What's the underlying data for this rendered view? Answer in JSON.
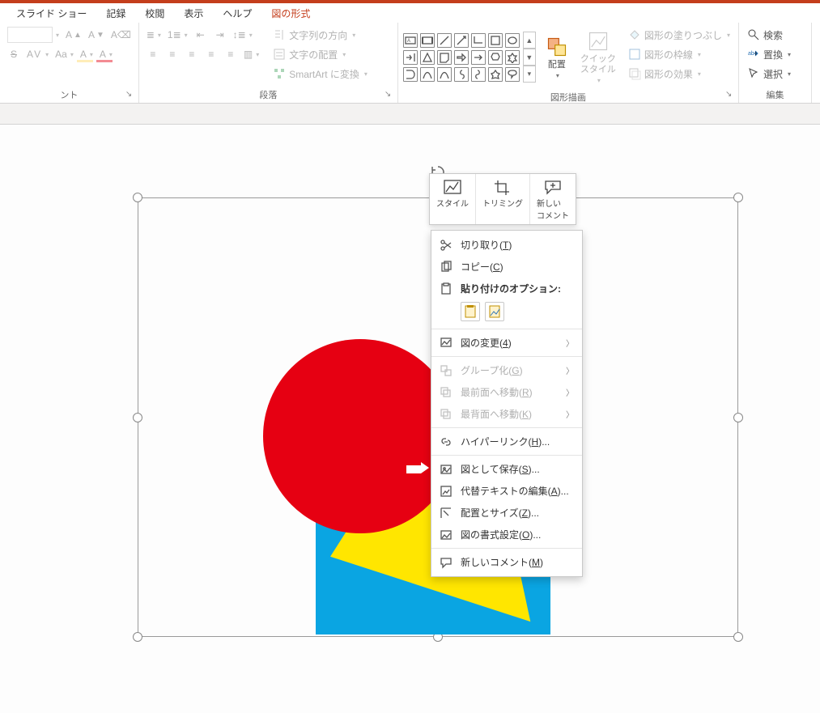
{
  "tabs": {
    "slideshow": "スライド ショー",
    "record": "記録",
    "review": "校閲",
    "view": "表示",
    "help": "ヘルプ",
    "picture_format": "図の形式"
  },
  "ribbon": {
    "font": {
      "label": "ント"
    },
    "paragraph": {
      "label": "段落",
      "text_direction": "文字列の方向",
      "text_align": "文字の配置",
      "smartart": "SmartArt に変換"
    },
    "drawing": {
      "label": "図形描画",
      "arrange": "配置",
      "quick_styles": "クイック\nスタイル",
      "shape_fill": "図形の塗りつぶし",
      "shape_outline": "図形の枠線",
      "shape_effects": "図形の効果"
    },
    "editing": {
      "label": "編集",
      "find": "検索",
      "replace": "置換",
      "select": "選択"
    }
  },
  "mini": {
    "style": "スタイル",
    "crop": "トリミング",
    "comment": "新しい\nコメント"
  },
  "ctx": {
    "cut": "切り取り(",
    "cut_k": "T",
    "copy": "コピー(",
    "copy_k": "C",
    "paste_header": "貼り付けのオプション:",
    "change_pic": "図の変更(",
    "change_pic_k": "4",
    "group": "グループ化(",
    "group_k": "G",
    "bring_front": "最前面へ移動(",
    "bring_front_k": "R",
    "send_back": "最背面へ移動(",
    "send_back_k": "K",
    "hyperlink": "ハイパーリンク(",
    "hyperlink_k": "H",
    "save_as_pic": "図として保存(",
    "save_as_pic_k": "S",
    "alt_text": "代替テキストの編集(",
    "alt_text_k": "A",
    "size_pos": "配置とサイズ(",
    "size_pos_k": "Z",
    "format_pic": "図の書式設定(",
    "format_pic_k": "O",
    "new_comment": "新しいコメント(",
    "new_comment_k": "M"
  }
}
